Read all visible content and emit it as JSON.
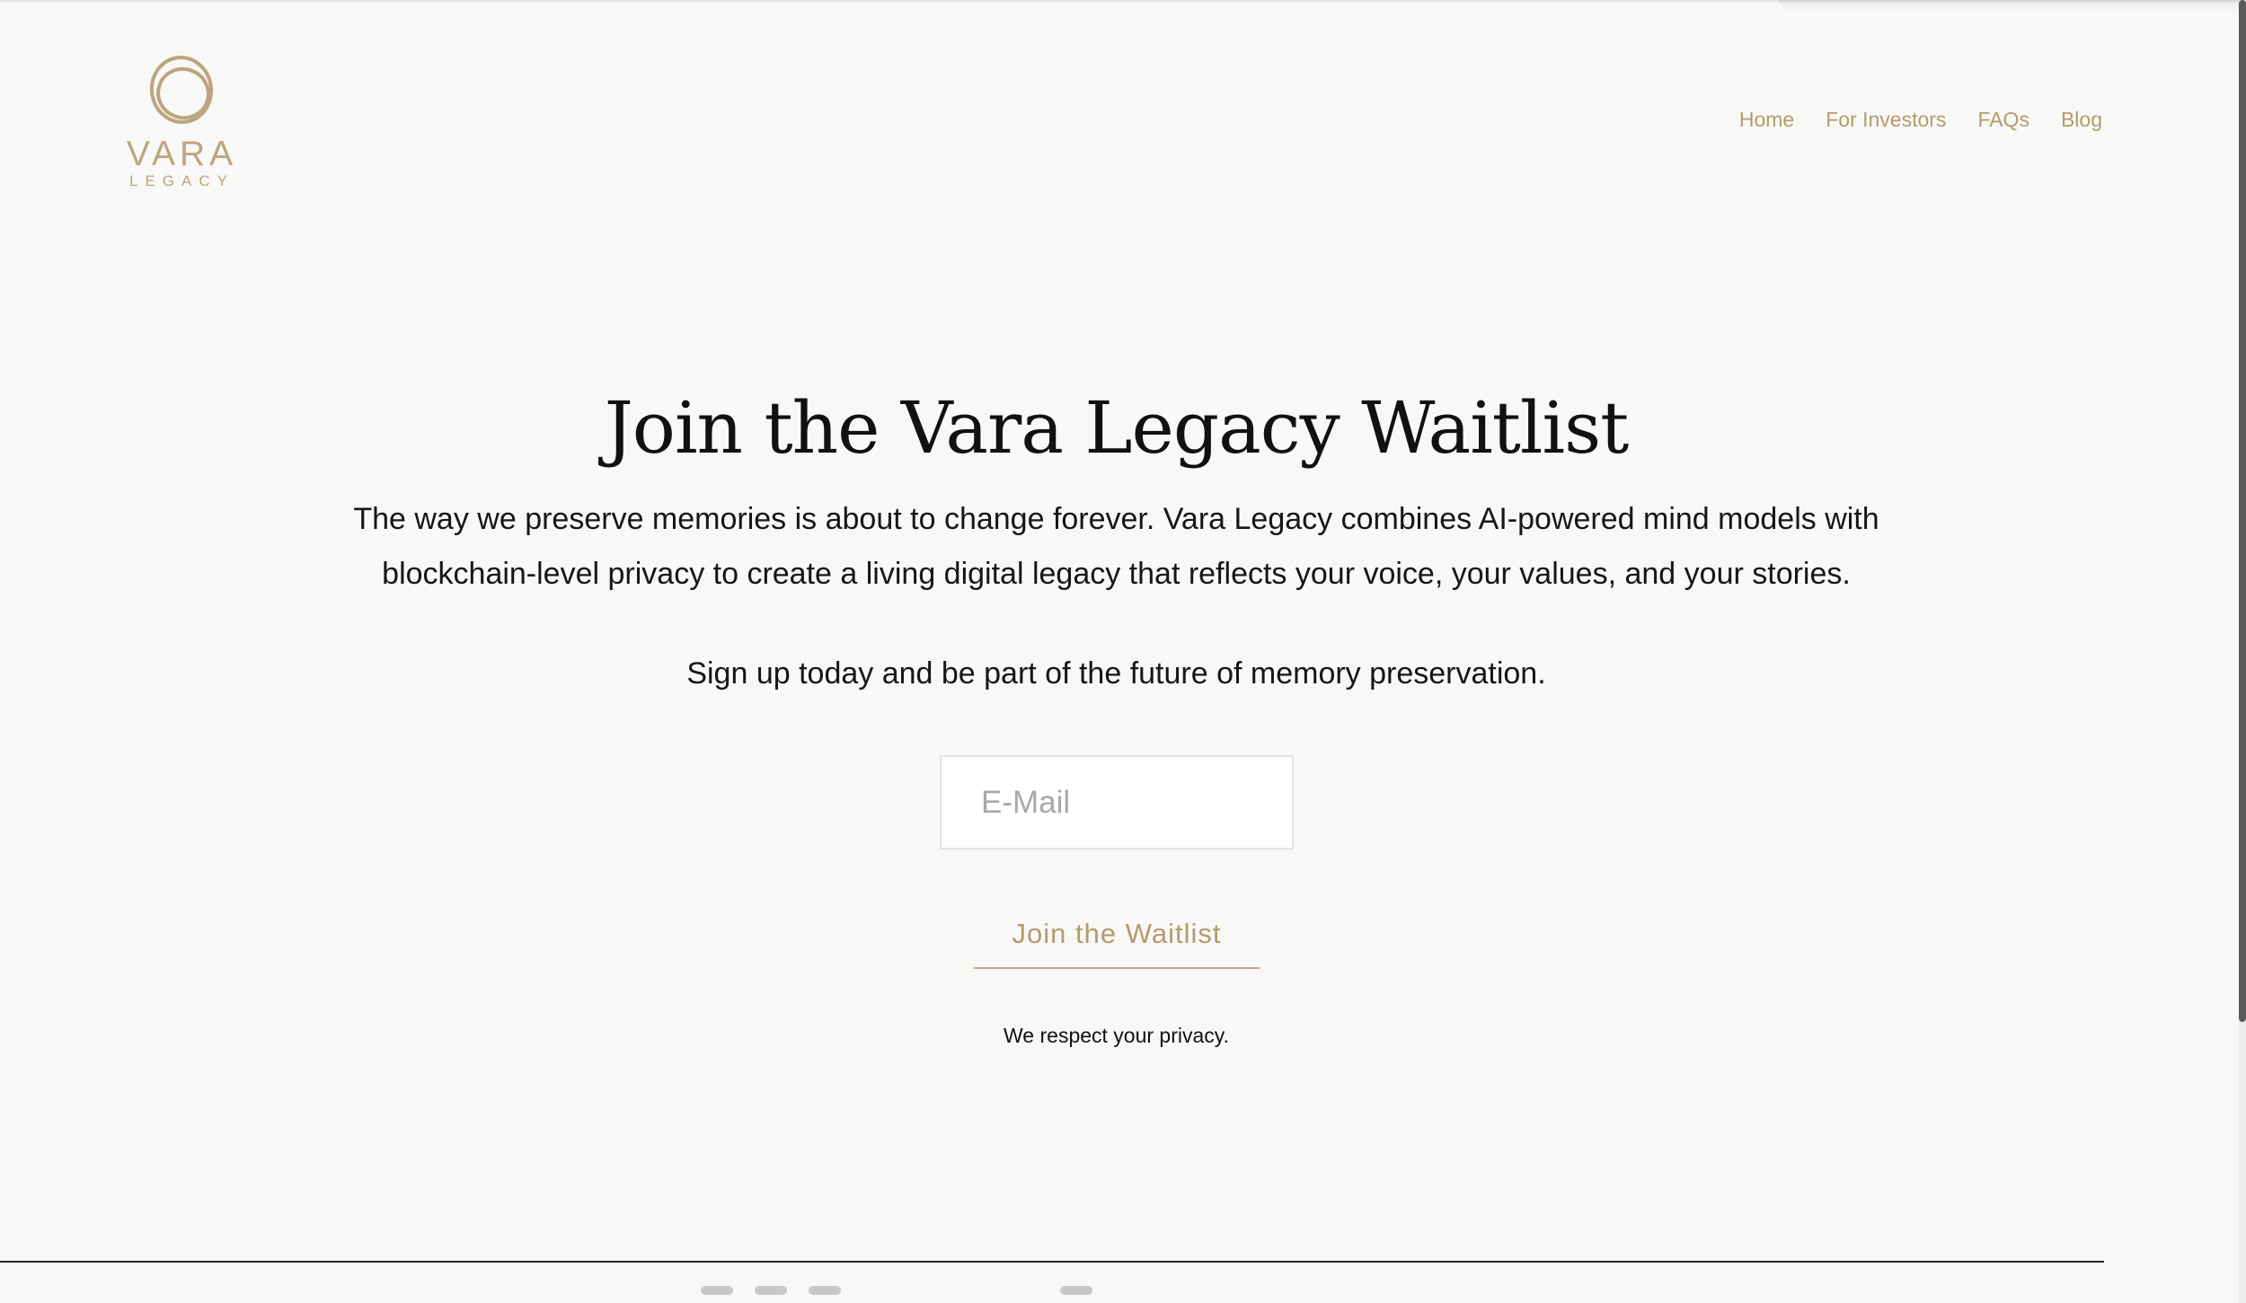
{
  "brand": {
    "name": "VARA",
    "subname": "LEGACY",
    "accent": "#b59a6d"
  },
  "nav": {
    "items": [
      {
        "label": "Home"
      },
      {
        "label": "For Investors"
      },
      {
        "label": "FAQs"
      },
      {
        "label": "Blog"
      }
    ]
  },
  "hero": {
    "title": "Join the Vara Legacy Waitlist",
    "description": "The way we preserve memories is about to change forever. Vara Legacy combines AI-powered mind models with blockchain-level privacy to create a living digital legacy that reflects your voice, your values, and your stories.",
    "cta_text": "Sign up today and be part of the future of memory preservation."
  },
  "form": {
    "email_placeholder": "E-Mail",
    "email_value": "",
    "submit_label": "Join the Waitlist",
    "privacy_note": "We respect your privacy."
  },
  "icons": {
    "logo": "vara-rings-logo-icon"
  }
}
